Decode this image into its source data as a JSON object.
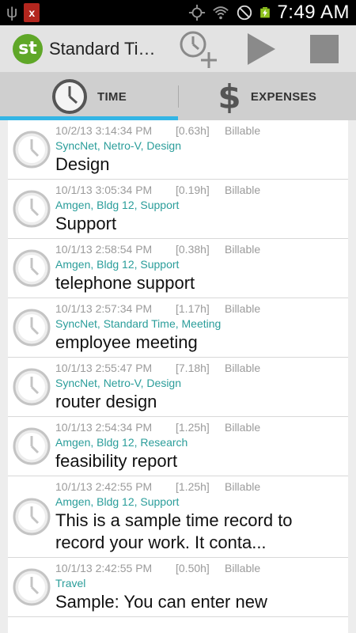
{
  "status_bar": {
    "time": "7:49 AM",
    "notification_icon": "x",
    "icons": [
      "usb-icon",
      "notification-icon",
      "gps-icon",
      "wifi-icon",
      "no-signal-icon",
      "battery-charging-icon"
    ]
  },
  "action_bar": {
    "logo_text": "st",
    "title": "Standard Time",
    "actions": [
      "add-time-record-icon",
      "play-icon",
      "stop-icon"
    ]
  },
  "tabs": [
    {
      "label": "TIME",
      "active": true,
      "icon": "clock-icon"
    },
    {
      "label": "EXPENSES",
      "active": false,
      "icon": "dollar-icon"
    }
  ],
  "records": [
    {
      "date": "10/2/13 3:14:34 PM",
      "hours": "[0.63h]",
      "billing": "Billable",
      "client": "SyncNet, Netro-V, Design",
      "description": "Design"
    },
    {
      "date": "10/1/13 3:05:34 PM",
      "hours": "[0.19h]",
      "billing": "Billable",
      "client": "Amgen, Bldg 12, Support",
      "description": "Support"
    },
    {
      "date": "10/1/13 2:58:54 PM",
      "hours": "[0.38h]",
      "billing": "Billable",
      "client": "Amgen, Bldg 12, Support",
      "description": "telephone support"
    },
    {
      "date": "10/1/13 2:57:34 PM",
      "hours": "[1.17h]",
      "billing": "Billable",
      "client": "SyncNet, Standard Time, Meeting",
      "description": "employee meeting"
    },
    {
      "date": "10/1/13 2:55:47 PM",
      "hours": "[7.18h]",
      "billing": "Billable",
      "client": "SyncNet, Netro-V, Design",
      "description": "router design"
    },
    {
      "date": "10/1/13 2:54:34 PM",
      "hours": "[1.25h]",
      "billing": "Billable",
      "client": "Amgen, Bldg 12, Research",
      "description": "feasibility report"
    },
    {
      "date": "10/1/13 2:42:55 PM",
      "hours": "[1.25h]",
      "billing": "Billable",
      "client": "Amgen, Bldg 12, Support",
      "description": "This is a sample time record to record your work.  It conta..."
    },
    {
      "date": "10/1/13 2:42:55 PM",
      "hours": "[0.50h]",
      "billing": "Billable",
      "client": "Travel",
      "description": "Sample: You can enter new"
    }
  ],
  "colors": {
    "accent": "#33b5e5",
    "client_text": "#2a9d9a",
    "logo": "#5fa728"
  }
}
